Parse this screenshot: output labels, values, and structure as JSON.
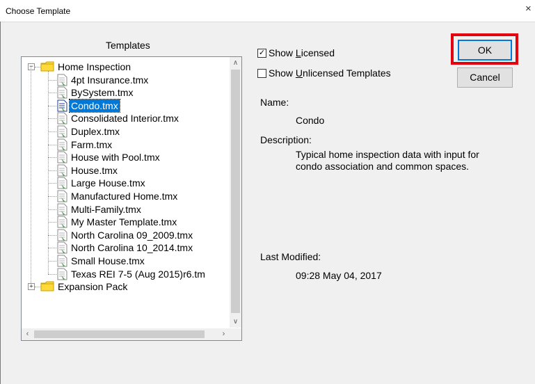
{
  "window": {
    "title": "Choose Template",
    "close_glyph": "×"
  },
  "templates_panel": {
    "label": "Templates",
    "tree": [
      {
        "label": "Home Inspection",
        "expanded": true,
        "children": [
          "4pt Insurance.tmx",
          "BySystem.tmx",
          "Condo.tmx",
          "Consolidated Interior.tmx",
          "Duplex.tmx",
          "Farm.tmx",
          "House with Pool.tmx",
          "House.tmx",
          "Large House.tmx",
          "Manufactured Home.tmx",
          "Multi-Family.tmx",
          "My Master Template.tmx",
          "North Carolina 09_2009.tmx",
          "North Carolina 10_2014.tmx",
          "Small House.tmx",
          "Texas REI 7-5 (Aug 2015)r6.tm"
        ]
      },
      {
        "label": "Expansion Pack",
        "expanded": false,
        "children": []
      }
    ],
    "selected": "Condo.tmx"
  },
  "options": {
    "show_licensed": {
      "prefix": "Show ",
      "underlined": "L",
      "rest": "icensed",
      "checked": true,
      "check_glyph": "✓"
    },
    "show_unlicensed": {
      "prefix": "Show ",
      "underlined": "U",
      "rest": "nlicensed Templates",
      "checked": false
    }
  },
  "buttons": {
    "ok": "OK",
    "cancel": "Cancel"
  },
  "details": {
    "name_label": "Name:",
    "name_value": "Condo",
    "description_label": "Description:",
    "description_line1": "Typical home inspection data with input for",
    "description_line2": "condo association and common spaces.",
    "last_modified_label": "Last Modified:",
    "last_modified_value": "09:28 May 04, 2017"
  },
  "colors": {
    "selection": "#0078d7",
    "highlight_box": "#e3000f",
    "folder": "#ffd83a"
  }
}
